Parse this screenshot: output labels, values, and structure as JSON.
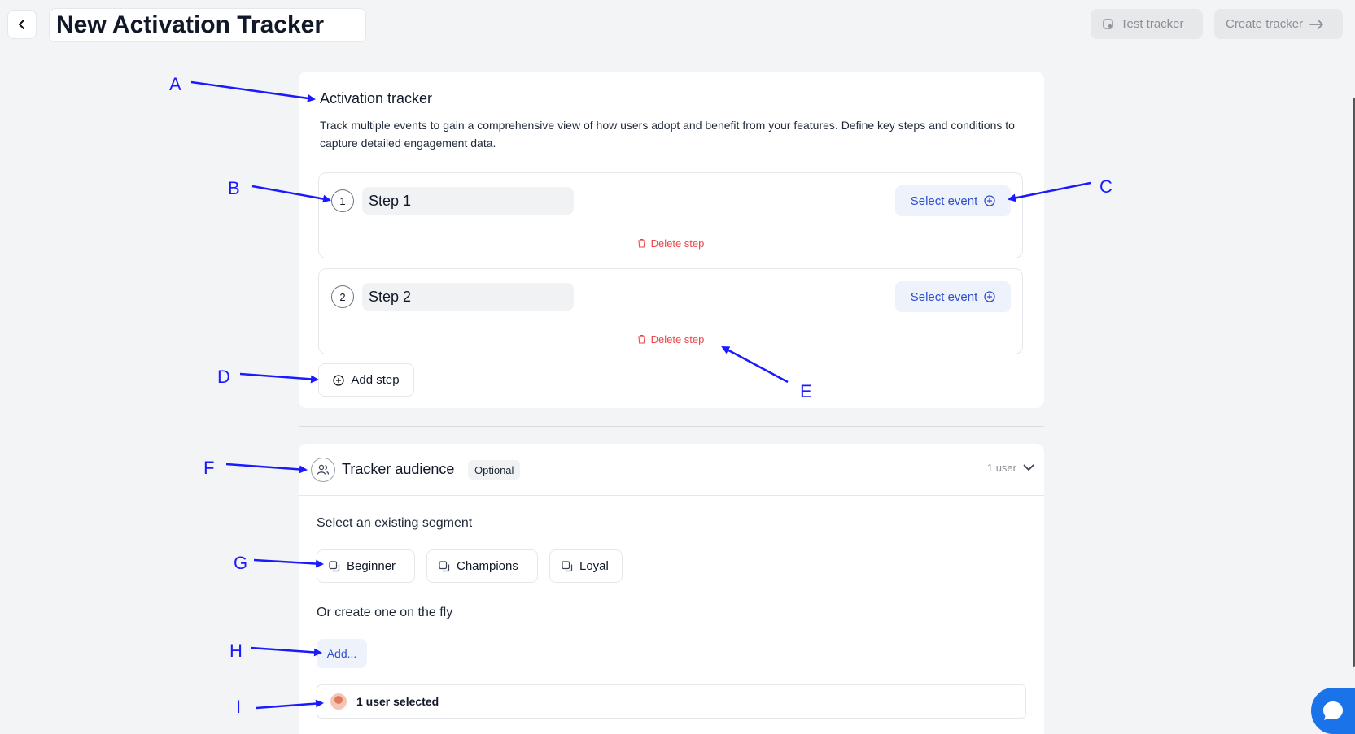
{
  "header": {
    "title": "New Activation Tracker",
    "test_label": "Test tracker",
    "create_label": "Create tracker"
  },
  "tracker": {
    "title": "Activation tracker",
    "description": "Track multiple events to gain a comprehensive view of how users adopt and benefit from your features. Define key steps and conditions to capture detailed engagement data.",
    "steps": [
      {
        "number": "1",
        "name": "Step 1",
        "select_label": "Select event",
        "delete_label": "Delete step"
      },
      {
        "number": "2",
        "name": "Step 2",
        "select_label": "Select event",
        "delete_label": "Delete step"
      }
    ],
    "add_step_label": "Add step"
  },
  "audience": {
    "title": "Tracker audience",
    "badge": "Optional",
    "user_count": "1 user",
    "segment_label": "Select an existing segment",
    "segments": [
      "Beginner",
      "Champions",
      "Loyal"
    ],
    "fly_label": "Or create one on the fly",
    "add_label": "Add...",
    "selected_text": "1 user selected"
  },
  "annotations": [
    "A",
    "B",
    "C",
    "D",
    "E",
    "F",
    "G",
    "H",
    "I"
  ],
  "colors": {
    "accent": "#2d4fd1",
    "danger": "#ef4444",
    "annotation": "#1a1aff",
    "background": "#f3f4f6"
  }
}
